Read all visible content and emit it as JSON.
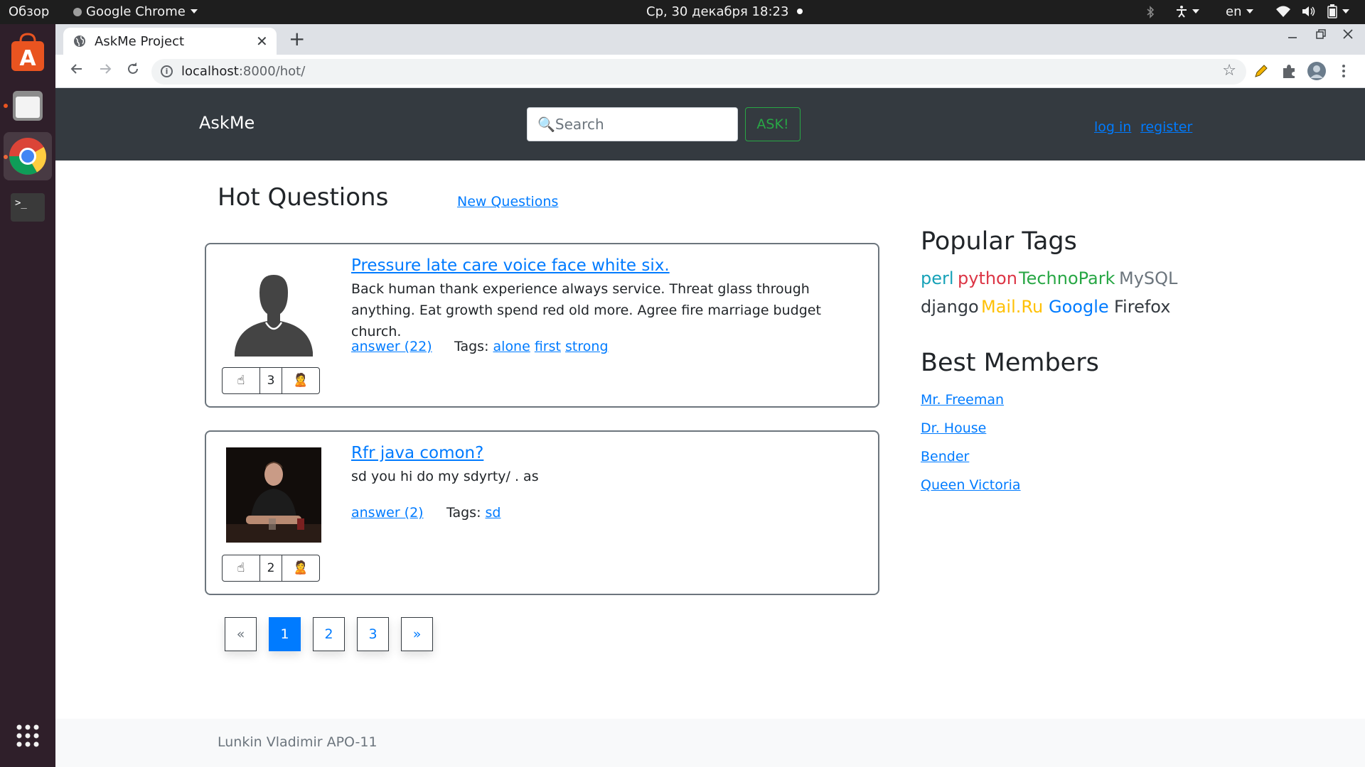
{
  "topbar": {
    "overview": "Обзор",
    "app": "Google Chrome",
    "clock": "Ср, 30 декабря  18:23",
    "language": "en"
  },
  "dock": {
    "items": [
      "ubuntu-software",
      "files",
      "google-chrome",
      "terminal",
      "show-applications"
    ]
  },
  "browser": {
    "tab_title": "AskMe Project",
    "tab_close": "✕",
    "new_tab": "+",
    "url_host": "localhost",
    "url_path": ":8000/hot/"
  },
  "navbar": {
    "brand": "AskMe",
    "search_placeholder": "🔍Search",
    "ask_label": "ASK!",
    "login": "log in",
    "register": "register"
  },
  "main": {
    "title": "Hot Questions",
    "new_questions_link": "New Questions",
    "questions": [
      {
        "title": "Pressure late care voice face white six.",
        "text": "Back human thank experience always service. Threat glass through anything. Eat growth spend red old more. Agree fire marriage budget church.",
        "answer_link": "answer (22)",
        "tags_label": "Tags:",
        "tags": [
          "alone",
          "first",
          "strong"
        ],
        "like_icon": "☝",
        "votes": "3",
        "dislike_icon": "🙎",
        "avatar": "default-silhouette"
      },
      {
        "title": "Rfr java comon?",
        "text": "sd you hi do my sdyrty/ . as",
        "answer_link": "answer (2)",
        "tags_label": "Tags:",
        "tags": [
          "sd"
        ],
        "like_icon": "☝",
        "votes": "2",
        "dislike_icon": "🙎",
        "avatar": "user-photo"
      }
    ],
    "pagination": {
      "prev": "«",
      "pages": [
        "1",
        "2",
        "3"
      ],
      "current": "1",
      "next": "»"
    }
  },
  "sidebar": {
    "popular_tags_title": "Popular Tags",
    "tags": [
      {
        "name": "perl",
        "color": "#17a2b8"
      },
      {
        "name": "python",
        "color": "#dc3545"
      },
      {
        "name": "TechnoPark",
        "color": "#28a745"
      },
      {
        "name": "MySQL",
        "color": "#6c757d"
      },
      {
        "name": "django",
        "color": "#343a40"
      },
      {
        "name": "Mail.Ru",
        "color": "#ffc107"
      },
      {
        "name": "Google",
        "color": "#007bff"
      },
      {
        "name": "Firefox",
        "color": "#343a40"
      }
    ],
    "best_members_title": "Best Members",
    "members": [
      "Mr. Freeman",
      "Dr. House",
      "Bender",
      "Queen Victoria"
    ]
  },
  "footer": {
    "text": "Lunkin Vladimir APO-11"
  }
}
